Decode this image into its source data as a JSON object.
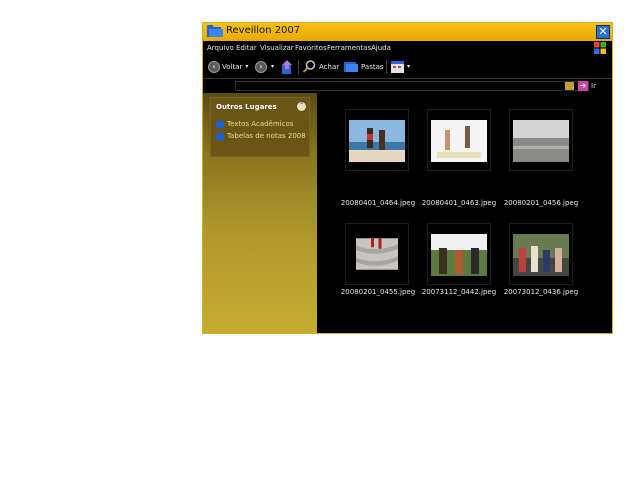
{
  "window": {
    "title": "Reveillon 2007",
    "close_glyph": "✕"
  },
  "menu": [
    "Arquivo",
    "Editar",
    "Visualizar",
    "Favoritos",
    "Ferramentas",
    "Ajuda"
  ],
  "toolbar": {
    "back_label": "Voltar",
    "search_label": "Achar",
    "folders_label": "Pastas"
  },
  "address": {
    "go_label": "Ir",
    "value": ""
  },
  "sidebar": {
    "panel_title": "Outros Lugares",
    "links": [
      "Textos Acadêmicos",
      "Tabelas de notas 2008"
    ]
  },
  "files": [
    {
      "name": "20080401_0464.jpeg"
    },
    {
      "name": "20080401_0463.jpeg"
    },
    {
      "name": "20080201_0456.jpeg"
    },
    {
      "name": "20080201_0455.jpeg"
    },
    {
      "name": "20073112_0442.jpeg"
    },
    {
      "name": "20073012_0436.jpeg"
    }
  ],
  "colors": {
    "titlebar": "#f0b410",
    "sidebar": "#b09a2c",
    "content_bg": "#000000"
  }
}
